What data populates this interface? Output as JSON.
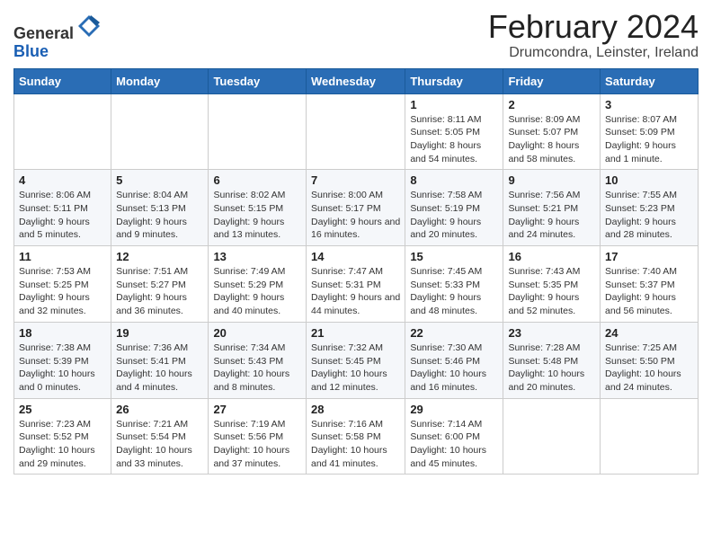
{
  "header": {
    "logo_general": "General",
    "logo_blue": "Blue",
    "month_title": "February 2024",
    "location": "Drumcondra, Leinster, Ireland"
  },
  "weekdays": [
    "Sunday",
    "Monday",
    "Tuesday",
    "Wednesday",
    "Thursday",
    "Friday",
    "Saturday"
  ],
  "weeks": [
    [
      {
        "day": "",
        "info": ""
      },
      {
        "day": "",
        "info": ""
      },
      {
        "day": "",
        "info": ""
      },
      {
        "day": "",
        "info": ""
      },
      {
        "day": "1",
        "info": "Sunrise: 8:11 AM\nSunset: 5:05 PM\nDaylight: 8 hours and 54 minutes."
      },
      {
        "day": "2",
        "info": "Sunrise: 8:09 AM\nSunset: 5:07 PM\nDaylight: 8 hours and 58 minutes."
      },
      {
        "day": "3",
        "info": "Sunrise: 8:07 AM\nSunset: 5:09 PM\nDaylight: 9 hours and 1 minute."
      }
    ],
    [
      {
        "day": "4",
        "info": "Sunrise: 8:06 AM\nSunset: 5:11 PM\nDaylight: 9 hours and 5 minutes."
      },
      {
        "day": "5",
        "info": "Sunrise: 8:04 AM\nSunset: 5:13 PM\nDaylight: 9 hours and 9 minutes."
      },
      {
        "day": "6",
        "info": "Sunrise: 8:02 AM\nSunset: 5:15 PM\nDaylight: 9 hours and 13 minutes."
      },
      {
        "day": "7",
        "info": "Sunrise: 8:00 AM\nSunset: 5:17 PM\nDaylight: 9 hours and 16 minutes."
      },
      {
        "day": "8",
        "info": "Sunrise: 7:58 AM\nSunset: 5:19 PM\nDaylight: 9 hours and 20 minutes."
      },
      {
        "day": "9",
        "info": "Sunrise: 7:56 AM\nSunset: 5:21 PM\nDaylight: 9 hours and 24 minutes."
      },
      {
        "day": "10",
        "info": "Sunrise: 7:55 AM\nSunset: 5:23 PM\nDaylight: 9 hours and 28 minutes."
      }
    ],
    [
      {
        "day": "11",
        "info": "Sunrise: 7:53 AM\nSunset: 5:25 PM\nDaylight: 9 hours and 32 minutes."
      },
      {
        "day": "12",
        "info": "Sunrise: 7:51 AM\nSunset: 5:27 PM\nDaylight: 9 hours and 36 minutes."
      },
      {
        "day": "13",
        "info": "Sunrise: 7:49 AM\nSunset: 5:29 PM\nDaylight: 9 hours and 40 minutes."
      },
      {
        "day": "14",
        "info": "Sunrise: 7:47 AM\nSunset: 5:31 PM\nDaylight: 9 hours and 44 minutes."
      },
      {
        "day": "15",
        "info": "Sunrise: 7:45 AM\nSunset: 5:33 PM\nDaylight: 9 hours and 48 minutes."
      },
      {
        "day": "16",
        "info": "Sunrise: 7:43 AM\nSunset: 5:35 PM\nDaylight: 9 hours and 52 minutes."
      },
      {
        "day": "17",
        "info": "Sunrise: 7:40 AM\nSunset: 5:37 PM\nDaylight: 9 hours and 56 minutes."
      }
    ],
    [
      {
        "day": "18",
        "info": "Sunrise: 7:38 AM\nSunset: 5:39 PM\nDaylight: 10 hours and 0 minutes."
      },
      {
        "day": "19",
        "info": "Sunrise: 7:36 AM\nSunset: 5:41 PM\nDaylight: 10 hours and 4 minutes."
      },
      {
        "day": "20",
        "info": "Sunrise: 7:34 AM\nSunset: 5:43 PM\nDaylight: 10 hours and 8 minutes."
      },
      {
        "day": "21",
        "info": "Sunrise: 7:32 AM\nSunset: 5:45 PM\nDaylight: 10 hours and 12 minutes."
      },
      {
        "day": "22",
        "info": "Sunrise: 7:30 AM\nSunset: 5:46 PM\nDaylight: 10 hours and 16 minutes."
      },
      {
        "day": "23",
        "info": "Sunrise: 7:28 AM\nSunset: 5:48 PM\nDaylight: 10 hours and 20 minutes."
      },
      {
        "day": "24",
        "info": "Sunrise: 7:25 AM\nSunset: 5:50 PM\nDaylight: 10 hours and 24 minutes."
      }
    ],
    [
      {
        "day": "25",
        "info": "Sunrise: 7:23 AM\nSunset: 5:52 PM\nDaylight: 10 hours and 29 minutes."
      },
      {
        "day": "26",
        "info": "Sunrise: 7:21 AM\nSunset: 5:54 PM\nDaylight: 10 hours and 33 minutes."
      },
      {
        "day": "27",
        "info": "Sunrise: 7:19 AM\nSunset: 5:56 PM\nDaylight: 10 hours and 37 minutes."
      },
      {
        "day": "28",
        "info": "Sunrise: 7:16 AM\nSunset: 5:58 PM\nDaylight: 10 hours and 41 minutes."
      },
      {
        "day": "29",
        "info": "Sunrise: 7:14 AM\nSunset: 6:00 PM\nDaylight: 10 hours and 45 minutes."
      },
      {
        "day": "",
        "info": ""
      },
      {
        "day": "",
        "info": ""
      }
    ]
  ]
}
